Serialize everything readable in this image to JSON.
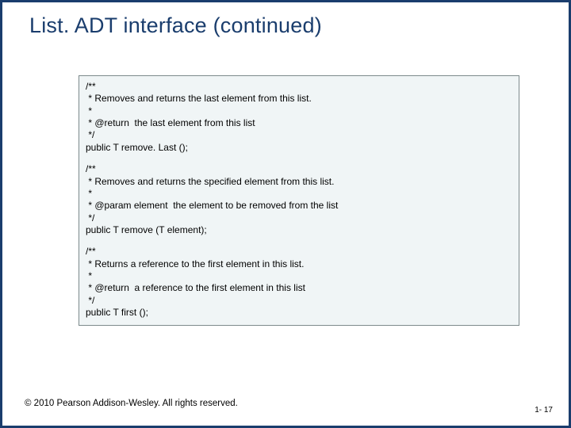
{
  "title": "List. ADT interface (continued)",
  "code": {
    "block1": {
      "l1": "/**",
      "l2": " * Removes and returns the last element from this list.",
      "l3": " *",
      "l4": " * @return  the last element from this list",
      "l5": " */",
      "l6": "public T remove. Last ();"
    },
    "block2": {
      "l1": "/**",
      "l2": " * Removes and returns the specified element from this list.",
      "l3": " *",
      "l4": " * @param element  the element to be removed from the list",
      "l5": " */",
      "l6": "public T remove (T element);"
    },
    "block3": {
      "l1": "/**",
      "l2": " * Returns a reference to the first element in this list.",
      "l3": " *",
      "l4": " * @return  a reference to the first element in this list",
      "l5": " */",
      "l6": "public T first ();"
    }
  },
  "copyright": "© 2010 Pearson Addison-Wesley. All rights reserved.",
  "pagenum": "1- 17"
}
